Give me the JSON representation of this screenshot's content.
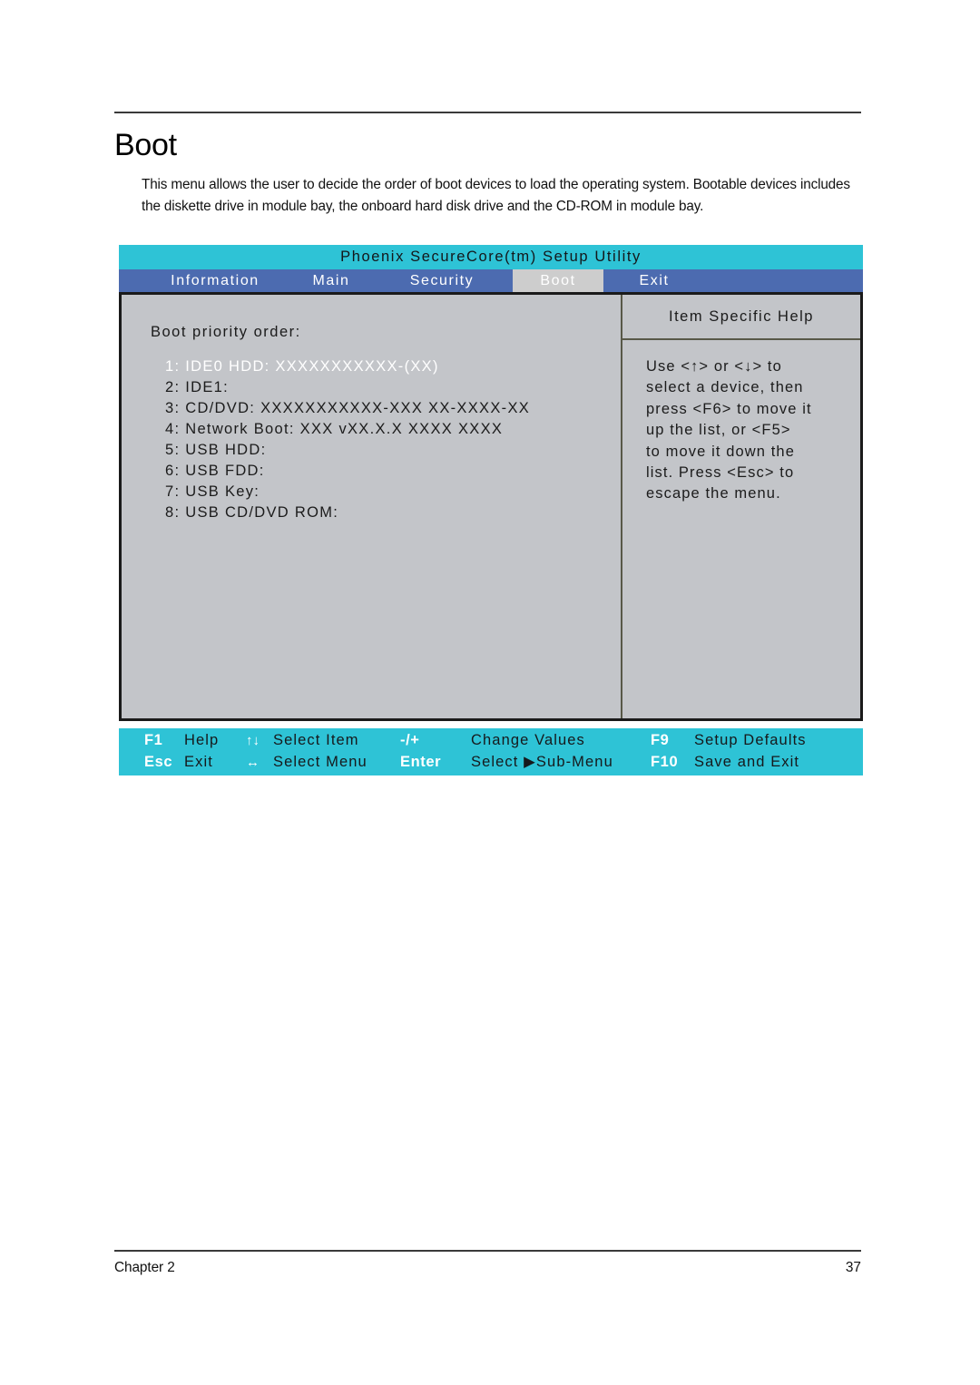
{
  "document": {
    "title": "Boot",
    "intro": "This menu allows the user to decide the order of boot devices to load the operating system. Bootable devices includes the diskette drive in module bay, the onboard hard disk drive and the CD-ROM in module bay.",
    "footer_left": "Chapter 2",
    "footer_right": "37"
  },
  "bios": {
    "title": "Phoenix SecureCore(tm) Setup Utility",
    "menu": {
      "items": [
        {
          "label": "Information",
          "active": false
        },
        {
          "label": "Main",
          "active": false
        },
        {
          "label": "Security",
          "active": false
        },
        {
          "label": "Boot",
          "active": true
        },
        {
          "label": "Exit",
          "active": false
        }
      ]
    },
    "boot": {
      "heading": "Boot priority order:",
      "items": [
        {
          "text": "1: IDE0 HDD: XXXXXXXXXXX-(XX)",
          "selected": true
        },
        {
          "text": "2: IDE1:",
          "selected": false
        },
        {
          "text": "3: CD/DVD: XXXXXXXXXXX-XXX XX-XXXX-XX",
          "selected": false
        },
        {
          "text": "4: Network Boot: XXX vXX.X.X  XXXX XXXX",
          "selected": false
        },
        {
          "text": "5: USB HDD:",
          "selected": false
        },
        {
          "text": "6: USB FDD:",
          "selected": false
        },
        {
          "text": "7: USB Key:",
          "selected": false
        },
        {
          "text": "8: USB CD/DVD ROM:",
          "selected": false
        }
      ]
    },
    "help": {
      "title": "Item Specific Help",
      "lines": [
        "Use <↑> or <↓> to",
        "select a device, then",
        "press <F6> to move it",
        "up the list, or <F5>",
        "to move it down the",
        "list. Press <Esc> to",
        "escape the menu."
      ]
    },
    "function_keys": {
      "row1": [
        {
          "key": "F1",
          "desc": "Help"
        },
        {
          "key": "↑↓",
          "desc": "Select Item",
          "icon": "up-down-arrow-icon"
        },
        {
          "key": "-/+",
          "desc": "Change Values"
        },
        {
          "key": "F9",
          "desc": "Setup Defaults"
        }
      ],
      "row2": [
        {
          "key": "Esc",
          "desc": "Exit"
        },
        {
          "key": "↔",
          "desc": "Select Menu",
          "icon": "left-right-arrow-icon"
        },
        {
          "key": "Enter",
          "desc": "Select  ▶Sub-Menu"
        },
        {
          "key": "F10",
          "desc": "Save and Exit"
        }
      ]
    }
  },
  "colors": {
    "title_bar": "#2ec3d6",
    "menu_bar": "#4c6bb0",
    "active_tab": "#cdcdcd",
    "panel_bg": "#c3c5c9",
    "fn_bar": "#2ec3d6",
    "selected_text": "#ffffff"
  }
}
